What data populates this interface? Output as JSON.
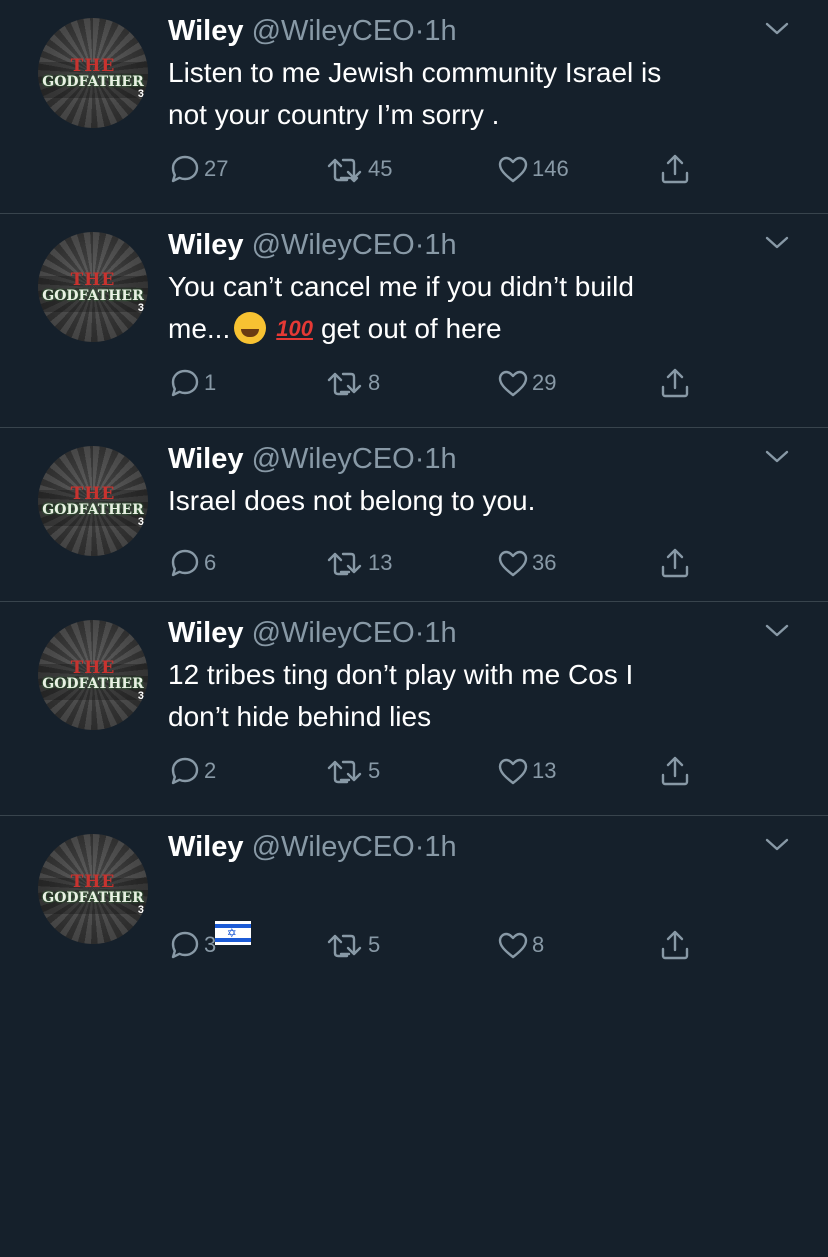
{
  "tweets": [
    {
      "name": "Wiley",
      "handle": "@WileyCEO",
      "dot": "·",
      "time": "1h",
      "text": "Listen to me Jewish community Israel is\nnot your country I’m sorry .",
      "replies": "27",
      "retweets": "45",
      "likes": "146"
    },
    {
      "name": "Wiley",
      "handle": "@WileyCEO",
      "dot": "·",
      "time": "1h",
      "text_line1": "You can’t cancel me if you didn’t build",
      "text_line2_start": "me...",
      "emoji_100": "100",
      "text_line2_end": "get out of here",
      "replies": "1",
      "retweets": "8",
      "likes": "29"
    },
    {
      "name": "Wiley",
      "handle": "@WileyCEO",
      "dot": "·",
      "time": "1h",
      "text": "Israel does not belong to you.",
      "replies": "6",
      "retweets": "13",
      "likes": "36"
    },
    {
      "name": "Wiley",
      "handle": "@WileyCEO",
      "dot": "·",
      "time": "1h",
      "text": "12 tribes ting don’t play with me Cos I\ndon’t hide behind lies",
      "replies": "2",
      "retweets": "5",
      "likes": "13"
    },
    {
      "name": "Wiley",
      "handle": "@WileyCEO",
      "dot": "·",
      "time": "1h",
      "replies": "3",
      "retweets": "5",
      "likes": "8"
    }
  ],
  "avatar": {
    "logo_top": "THE",
    "logo_main": "GODFATHER",
    "logo_num": "3"
  },
  "colors": {
    "background": "#15202b",
    "muted": "#8899a6",
    "divider": "#38444d",
    "text": "#ffffff"
  },
  "icons": [
    "reply-icon",
    "retweet-icon",
    "like-icon",
    "share-icon",
    "chevron-down-icon"
  ]
}
